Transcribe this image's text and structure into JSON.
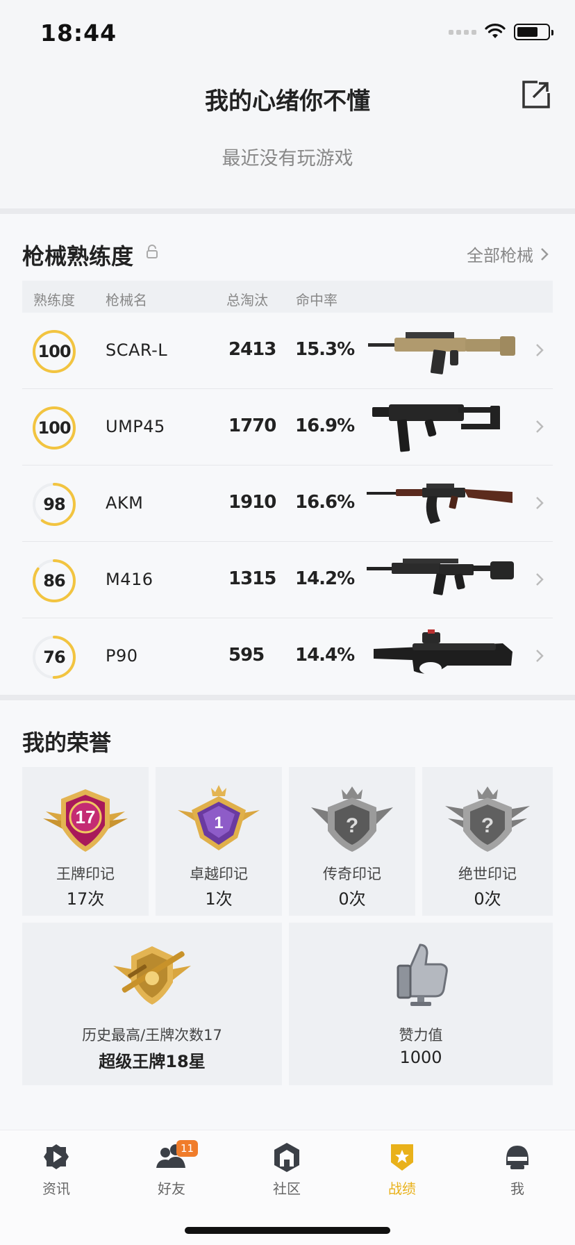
{
  "status_bar": {
    "time": "18:44",
    "battery_fraction": 0.7
  },
  "header": {
    "title": "我的心绪你不懂",
    "subtitle": "最近没有玩游戏",
    "share_icon": "share-icon"
  },
  "weapons": {
    "title": "枪械熟练度",
    "all_link": "全部枪械",
    "columns": {
      "proficiency": "熟练度",
      "name": "枪械名",
      "kills": "总淘汰",
      "accuracy": "命中率"
    },
    "rows": [
      {
        "proficiency": "100",
        "name": "SCAR-L",
        "kills": "2413",
        "accuracy": "15.3%",
        "gun": "scar-l-rifle",
        "progress": 1.0
      },
      {
        "proficiency": "100",
        "name": "UMP45",
        "kills": "1770",
        "accuracy": "16.9%",
        "gun": "ump45-smg",
        "progress": 1.0
      },
      {
        "proficiency": "98",
        "name": "AKM",
        "kills": "1910",
        "accuracy": "16.6%",
        "gun": "akm-rifle",
        "progress": 0.6
      },
      {
        "proficiency": "86",
        "name": "M416",
        "kills": "1315",
        "accuracy": "14.2%",
        "gun": "m416-rifle",
        "progress": 0.85
      },
      {
        "proficiency": "76",
        "name": "P90",
        "kills": "595",
        "accuracy": "14.4%",
        "gun": "p90-smg",
        "progress": 0.5
      }
    ]
  },
  "honors": {
    "title": "我的荣誉",
    "cards": [
      {
        "label": "王牌印记",
        "value": "17次",
        "badge_number": "17"
      },
      {
        "label": "卓越印记",
        "value": "1次",
        "badge_number": "1"
      },
      {
        "label": "传奇印记",
        "value": "0次",
        "badge_number": "?"
      },
      {
        "label": "绝世印记",
        "value": "0次",
        "badge_number": "?"
      }
    ],
    "wide_cards": [
      {
        "label": "历史最高/王牌次数17",
        "value": "超级王牌18星",
        "icon": "ace-rifle-badge-icon"
      },
      {
        "label": "赞力值",
        "value": "1000",
        "icon": "thumbs-up-icon"
      }
    ]
  },
  "tabbar": {
    "tabs": [
      {
        "label": "资讯",
        "icon": "news-play-icon",
        "active": false
      },
      {
        "label": "好友",
        "icon": "friends-icon",
        "active": false,
        "badge": "11"
      },
      {
        "label": "社区",
        "icon": "community-icon",
        "active": false
      },
      {
        "label": "战绩",
        "icon": "record-star-icon",
        "active": true
      },
      {
        "label": "我",
        "icon": "helmet-icon",
        "active": false
      }
    ]
  },
  "colors": {
    "accent": "#e9b11a",
    "badge_orange": "#f07c2a",
    "text_primary": "#222222",
    "text_secondary": "#888888"
  }
}
